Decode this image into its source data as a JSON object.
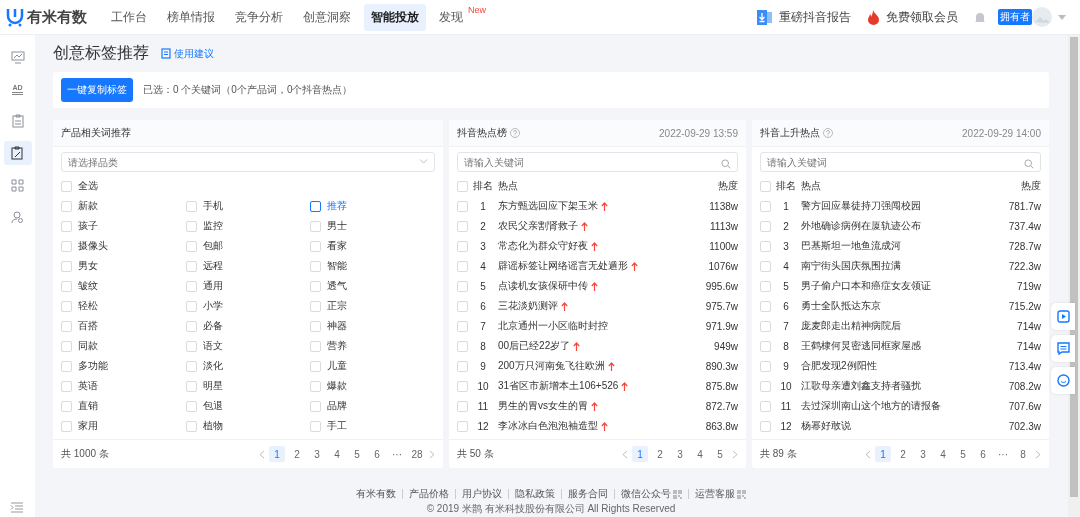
{
  "topbar": {
    "logo": "有米有数",
    "tabs": [
      {
        "label": "工作台",
        "selected": false
      },
      {
        "label": "榜单情报",
        "selected": false
      },
      {
        "label": "竞争分析",
        "selected": false
      },
      {
        "label": "创意洞察",
        "selected": false
      },
      {
        "label": "智能投放",
        "selected": true
      },
      {
        "label": "发现",
        "selected": false,
        "badge": "New"
      }
    ],
    "report_link": "重磅抖音报告",
    "member_link": "免费领取会员",
    "role_badge": "拥有者"
  },
  "sidebar": {
    "items": [
      {
        "selected": false
      },
      {
        "selected": false,
        "label": "AD"
      },
      {
        "selected": false
      },
      {
        "selected": true
      },
      {
        "selected": false
      },
      {
        "selected": false
      }
    ]
  },
  "page": {
    "title": "创意标签推荐",
    "help_link": "使用建议",
    "copy_button": "一键复制标签",
    "selection_summary": "已选：0 个关键词（0个产品词，0个抖音热点）"
  },
  "product_panel": {
    "title": "产品相关词推荐",
    "category_placeholder": "请选择品类",
    "select_all": {
      "label": "全选",
      "checked": false
    },
    "tags": [
      {
        "label": "新款",
        "checked": false,
        "highlighted": false
      },
      {
        "label": "手机",
        "checked": false,
        "highlighted": false
      },
      {
        "label": "推荐",
        "checked": false,
        "highlighted": true
      },
      {
        "label": "孩子",
        "checked": false,
        "highlighted": false
      },
      {
        "label": "监控",
        "checked": false,
        "highlighted": false
      },
      {
        "label": "男士",
        "checked": false,
        "highlighted": false
      },
      {
        "label": "摄像头",
        "checked": false,
        "highlighted": false
      },
      {
        "label": "包邮",
        "checked": false,
        "highlighted": false
      },
      {
        "label": "看家",
        "checked": false,
        "highlighted": false
      },
      {
        "label": "男女",
        "checked": false,
        "highlighted": false
      },
      {
        "label": "远程",
        "checked": false,
        "highlighted": false
      },
      {
        "label": "智能",
        "checked": false,
        "highlighted": false
      },
      {
        "label": "皱纹",
        "checked": false,
        "highlighted": false
      },
      {
        "label": "通用",
        "checked": false,
        "highlighted": false
      },
      {
        "label": "透气",
        "checked": false,
        "highlighted": false
      },
      {
        "label": "轻松",
        "checked": false,
        "highlighted": false
      },
      {
        "label": "小学",
        "checked": false,
        "highlighted": false
      },
      {
        "label": "正宗",
        "checked": false,
        "highlighted": false
      },
      {
        "label": "百搭",
        "checked": false,
        "highlighted": false
      },
      {
        "label": "必备",
        "checked": false,
        "highlighted": false
      },
      {
        "label": "神器",
        "checked": false,
        "highlighted": false
      },
      {
        "label": "同款",
        "checked": false,
        "highlighted": false
      },
      {
        "label": "语文",
        "checked": false,
        "highlighted": false
      },
      {
        "label": "营养",
        "checked": false,
        "highlighted": false
      },
      {
        "label": "多功能",
        "checked": false,
        "highlighted": false
      },
      {
        "label": "淡化",
        "checked": false,
        "highlighted": false
      },
      {
        "label": "儿童",
        "checked": false,
        "highlighted": false
      },
      {
        "label": "英语",
        "checked": false,
        "highlighted": false
      },
      {
        "label": "明星",
        "checked": false,
        "highlighted": false
      },
      {
        "label": "爆款",
        "checked": false,
        "highlighted": false
      },
      {
        "label": "直销",
        "checked": false,
        "highlighted": false
      },
      {
        "label": "包退",
        "checked": false,
        "highlighted": false
      },
      {
        "label": "品牌",
        "checked": false,
        "highlighted": false
      },
      {
        "label": "家用",
        "checked": false,
        "highlighted": false
      },
      {
        "label": "植物",
        "checked": false,
        "highlighted": false
      },
      {
        "label": "手工",
        "checked": false,
        "highlighted": false
      }
    ],
    "total": "共 1000 条",
    "pages": [
      {
        "label": "1",
        "selected": true
      },
      {
        "label": "2",
        "selected": false
      },
      {
        "label": "3",
        "selected": false
      },
      {
        "label": "4",
        "selected": false
      },
      {
        "label": "5",
        "selected": false
      },
      {
        "label": "6",
        "selected": false
      },
      {
        "label": "···",
        "selected": false
      },
      {
        "label": "28",
        "selected": false
      }
    ]
  },
  "hot_lists": [
    {
      "title": "抖音热点榜",
      "updated": "2022-09-29 13:59",
      "search_placeholder": "请输入关键词",
      "all_checked": false,
      "columns": [
        "排名",
        "热点",
        "热度"
      ],
      "rows": [
        {
          "rank": "1",
          "topic": "东方甄选回应下架玉米",
          "heat": "1138w",
          "rising": true,
          "checked": false
        },
        {
          "rank": "2",
          "topic": "农民父亲割肾救子",
          "heat": "1113w",
          "rising": true,
          "checked": false
        },
        {
          "rank": "3",
          "topic": "常态化为群众守好夜",
          "heat": "1100w",
          "rising": true,
          "checked": false
        },
        {
          "rank": "4",
          "topic": "辟谣标签让网络谣言无处遁形",
          "heat": "1076w",
          "rising": true,
          "checked": false
        },
        {
          "rank": "5",
          "topic": "点读机女孩保研中传",
          "heat": "995.6w",
          "rising": true,
          "checked": false
        },
        {
          "rank": "6",
          "topic": "三花淡奶测评",
          "heat": "975.7w",
          "rising": true,
          "checked": false
        },
        {
          "rank": "7",
          "topic": "北京通州一小区临时封控",
          "heat": "971.9w",
          "rising": false,
          "checked": false
        },
        {
          "rank": "8",
          "topic": "00后已经22岁了",
          "heat": "949w",
          "rising": true,
          "checked": false
        },
        {
          "rank": "9",
          "topic": "200万只河南兔飞往欧洲",
          "heat": "890.3w",
          "rising": true,
          "checked": false
        },
        {
          "rank": "10",
          "topic": "31省区市新增本土106+526",
          "heat": "875.8w",
          "rising": true,
          "checked": false
        },
        {
          "rank": "11",
          "topic": "男生的胃vs女生的胃",
          "heat": "872.7w",
          "rising": true,
          "checked": false
        },
        {
          "rank": "12",
          "topic": "李冰冰白色泡泡袖造型",
          "heat": "863.8w",
          "rising": true,
          "checked": false
        }
      ],
      "total": "共 50 条",
      "pages": [
        {
          "label": "1",
          "selected": true
        },
        {
          "label": "2",
          "selected": false
        },
        {
          "label": "3",
          "selected": false
        },
        {
          "label": "4",
          "selected": false
        },
        {
          "label": "5",
          "selected": false
        }
      ]
    },
    {
      "title": "抖音上升热点",
      "updated": "2022-09-29 14:00",
      "search_placeholder": "请输入关键词",
      "all_checked": false,
      "columns": [
        "排名",
        "热点",
        "热度"
      ],
      "rows": [
        {
          "rank": "1",
          "topic": "警方回应暴徒持刀强闯校园",
          "heat": "781.7w",
          "rising": false,
          "checked": false
        },
        {
          "rank": "2",
          "topic": "外地确诊病例在厦轨迹公布",
          "heat": "737.4w",
          "rising": false,
          "checked": false
        },
        {
          "rank": "3",
          "topic": "巴基斯坦一地鱼流成河",
          "heat": "728.7w",
          "rising": false,
          "checked": false
        },
        {
          "rank": "4",
          "topic": "南宁街头国庆氛围拉满",
          "heat": "722.3w",
          "rising": false,
          "checked": false
        },
        {
          "rank": "5",
          "topic": "男子偷户口本和癌症女友领证",
          "heat": "719w",
          "rising": false,
          "checked": false
        },
        {
          "rank": "6",
          "topic": "勇士全队抵达东京",
          "heat": "715.2w",
          "rising": false,
          "checked": false
        },
        {
          "rank": "7",
          "topic": "庞麦郎走出精神病院后",
          "heat": "714w",
          "rising": false,
          "checked": false
        },
        {
          "rank": "8",
          "topic": "王鹤棣何炅密逃同框家屋感",
          "heat": "714w",
          "rising": false,
          "checked": false
        },
        {
          "rank": "9",
          "topic": "合肥发现2例阳性",
          "heat": "713.4w",
          "rising": false,
          "checked": false
        },
        {
          "rank": "10",
          "topic": "江歌母亲遭刘鑫支持者骚扰",
          "heat": "708.2w",
          "rising": false,
          "checked": false
        },
        {
          "rank": "11",
          "topic": "去过深圳南山这个地方的请报备",
          "heat": "707.6w",
          "rising": false,
          "checked": false
        },
        {
          "rank": "12",
          "topic": "杨幂好敢说",
          "heat": "702.3w",
          "rising": false,
          "checked": false
        }
      ],
      "total": "共 89 条",
      "pages": [
        {
          "label": "1",
          "selected": true
        },
        {
          "label": "2",
          "selected": false
        },
        {
          "label": "3",
          "selected": false
        },
        {
          "label": "4",
          "selected": false
        },
        {
          "label": "5",
          "selected": false
        },
        {
          "label": "6",
          "selected": false
        },
        {
          "label": "···",
          "selected": false
        },
        {
          "label": "8",
          "selected": false
        }
      ]
    }
  ],
  "footer": {
    "links": [
      {
        "label": "有米有数",
        "qr": false
      },
      {
        "label": "产品价格",
        "qr": false
      },
      {
        "label": "用户协议",
        "qr": false
      },
      {
        "label": "隐私政策",
        "qr": false
      },
      {
        "label": "服务合同",
        "qr": false
      },
      {
        "label": "微信公众号",
        "qr": true
      },
      {
        "label": "运营客服",
        "qr": true
      }
    ],
    "copyright": "© 2019 米鹊 有米科技股份有限公司 All Rights Reserved"
  }
}
